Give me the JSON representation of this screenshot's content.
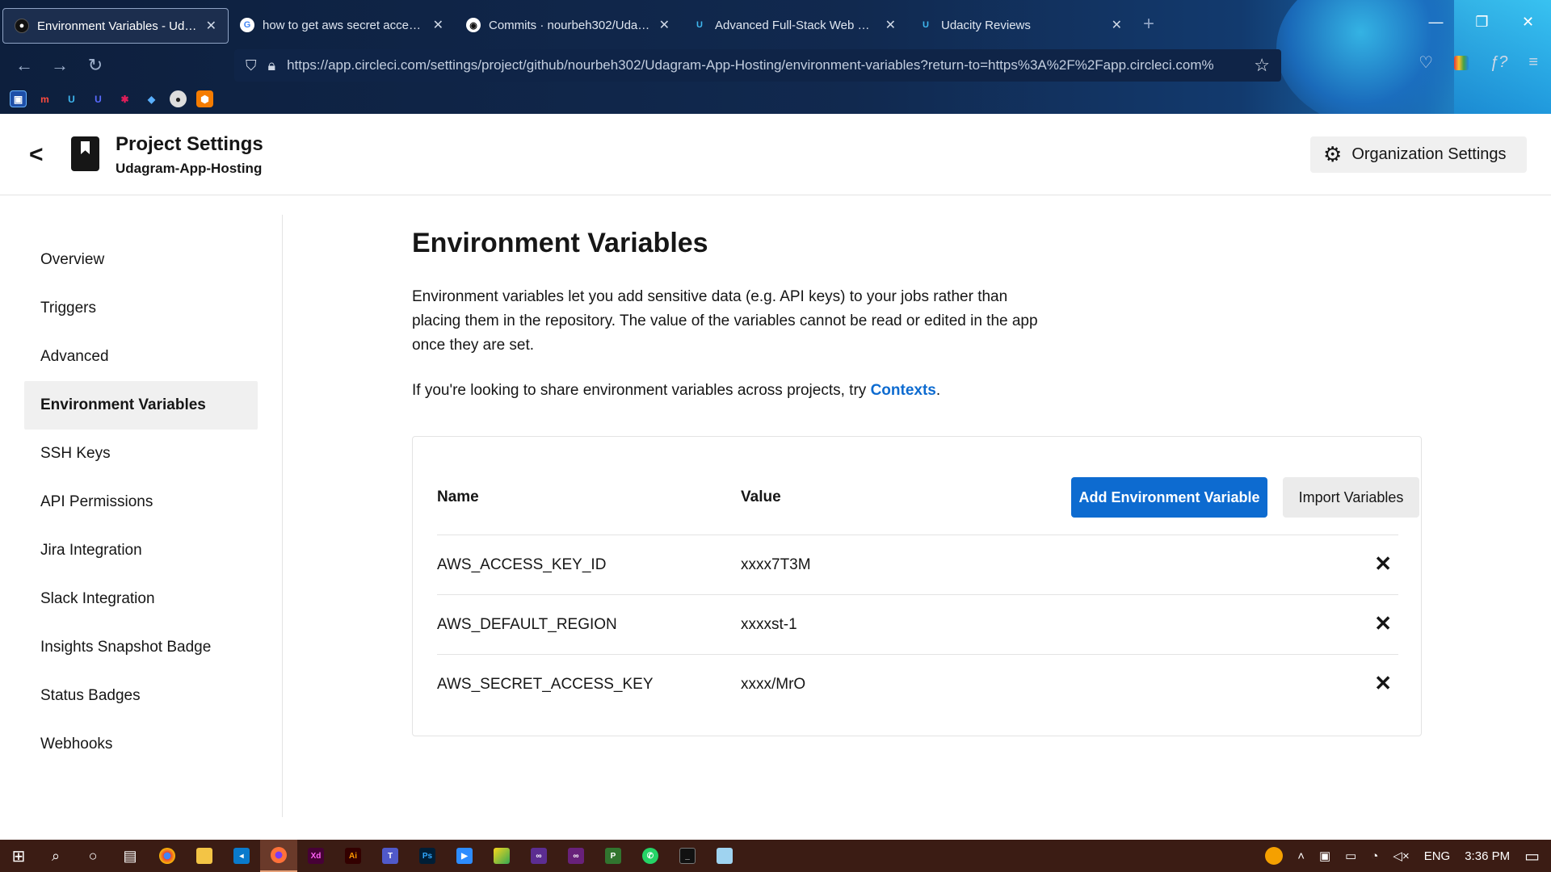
{
  "browser": {
    "tabs": [
      {
        "title": "Environment Variables - Udagra",
        "icon": "circleci-icon",
        "active": true
      },
      {
        "title": "how to get aws secret access ke",
        "icon": "google-icon",
        "active": false
      },
      {
        "title": "Commits · nourbeh302/Udagran",
        "icon": "github-icon",
        "active": false
      },
      {
        "title": "Advanced Full-Stack Web Devel",
        "icon": "udacity-icon",
        "active": false
      },
      {
        "title": "Udacity Reviews",
        "icon": "udacity-icon",
        "active": false
      }
    ],
    "url": "https://app.circleci.com/settings/project/github/nourbeh302/Udagram-App-Hosting/environment-variables?return-to=https%3A%2F%2Fapp.circleci.com%"
  },
  "header": {
    "title": "Project Settings",
    "subtitle": "Udagram-App-Hosting",
    "org_button": "Organization Settings"
  },
  "sidebar": {
    "items": [
      {
        "label": "Overview",
        "active": false
      },
      {
        "label": "Triggers",
        "active": false
      },
      {
        "label": "Advanced",
        "active": false
      },
      {
        "label": "Environment Variables",
        "active": true
      },
      {
        "label": "SSH Keys",
        "active": false
      },
      {
        "label": "API Permissions",
        "active": false
      },
      {
        "label": "Jira Integration",
        "active": false
      },
      {
        "label": "Slack Integration",
        "active": false
      },
      {
        "label": "Insights Snapshot Badge",
        "active": false
      },
      {
        "label": "Status Badges",
        "active": false
      },
      {
        "label": "Webhooks",
        "active": false
      }
    ]
  },
  "main": {
    "title": "Environment Variables",
    "description": "Environment variables let you add sensitive data (e.g. API keys) to your jobs rather than placing them in the repository. The value of the variables cannot be read or edited in the app once they are set.",
    "share_text": "If you're looking to share environment variables across projects, try ",
    "share_link": "Contexts",
    "share_end": ".",
    "table": {
      "col_name": "Name",
      "col_value": "Value",
      "add_button": "Add Environment Variable",
      "import_button": "Import Variables",
      "rows": [
        {
          "name": "AWS_ACCESS_KEY_ID",
          "value": "xxxx7T3M"
        },
        {
          "name": "AWS_DEFAULT_REGION",
          "value": "xxxxst-1"
        },
        {
          "name": "AWS_SECRET_ACCESS_KEY",
          "value": "xxxx/MrO"
        }
      ]
    }
  },
  "taskbar": {
    "language": "ENG",
    "time": "3:36 PM"
  },
  "colors": {
    "primary_blue": "#0d6bd0",
    "link_blue": "#0d6bd0",
    "taskbar_bg": "#3b1c14"
  }
}
